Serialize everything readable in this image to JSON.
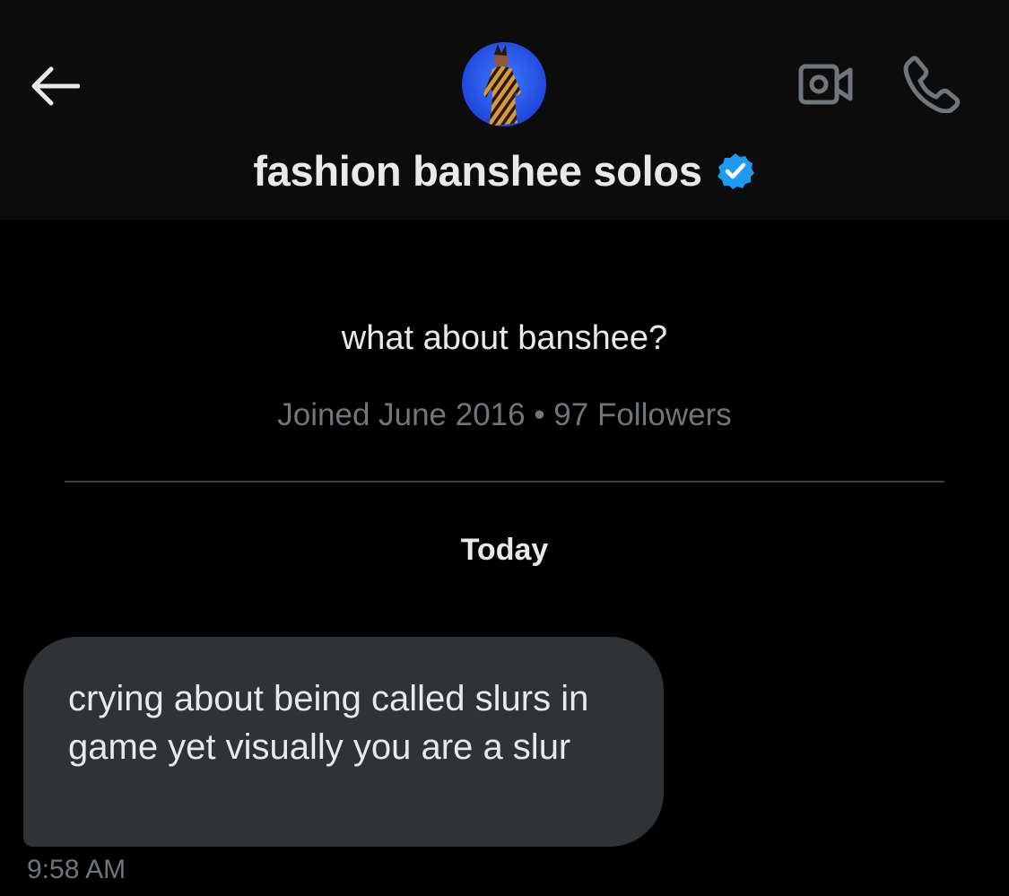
{
  "header": {
    "display_name": "fashion banshee solos",
    "icons": {
      "back": "arrow-left-icon",
      "video": "video-camera-icon",
      "phone": "phone-icon",
      "verified": "verified-badge-icon"
    },
    "verified_color": "#1d9bf0"
  },
  "profile": {
    "bio": "what about banshee?",
    "meta": "Joined June 2016 • 97 Followers"
  },
  "conversation": {
    "date_separator": "Today",
    "messages": [
      {
        "text": "crying about being called slurs in game yet visually you are a slur",
        "time": "9:58 AM"
      }
    ]
  }
}
